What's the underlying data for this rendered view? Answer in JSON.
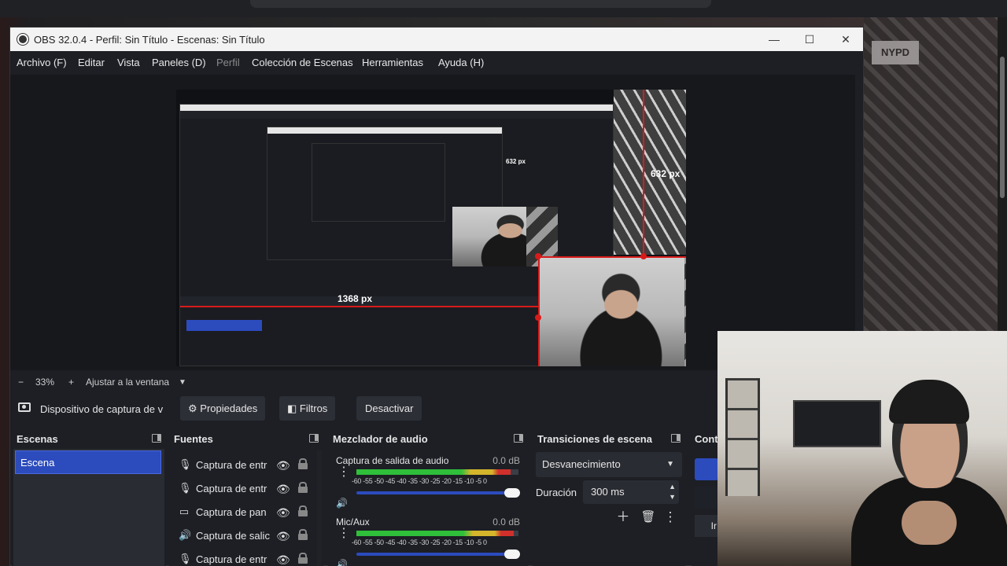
{
  "window": {
    "title": "OBS 32.0.4 - Perfil: Sin Título - Escenas: Sin Título",
    "minimize": "—",
    "maximize": "☐",
    "close": "✕"
  },
  "menu": [
    "Archivo (F)",
    "Editar",
    "Vista",
    "Paneles (D)",
    "Perfil",
    "Colección de Escenas",
    "Herramientas",
    "Ayuda (H)"
  ],
  "preview": {
    "label_height": "632 px",
    "label_width": "1368 px",
    "nested_label_height": "632 px",
    "nested_label_width": "1368 px",
    "tower_text": "NYPD"
  },
  "zoom": {
    "minus": "−",
    "value": "33%",
    "plus": "+",
    "fit": "Ajustar a la ventana",
    "caret": "▼"
  },
  "source_toolbar": {
    "source_name": "Dispositivo de captura de v",
    "properties": "Propiedades",
    "filters": "Filtros",
    "deactivate": "Desactivar"
  },
  "scenes": {
    "title": "Escenas",
    "items": [
      "Escena"
    ]
  },
  "sources": {
    "title": "Fuentes",
    "items": [
      {
        "label": "Captura de entr",
        "icon": "mic-icon"
      },
      {
        "label": "Captura de entr",
        "icon": "mic-icon"
      },
      {
        "label": "Captura de pan",
        "icon": "monitor-icon"
      },
      {
        "label": "Captura de salic",
        "icon": "speaker-icon"
      },
      {
        "label": "Captura de entr",
        "icon": "mic-icon"
      }
    ]
  },
  "mixer": {
    "title": "Mezclador de audio",
    "scale": "-60 -55 -50 -45 -40 -35 -30 -25 -20 -15 -10 -5 0",
    "channels": [
      {
        "name": "Captura de salida de audio",
        "db": "0.0 dB",
        "level": 0.95
      },
      {
        "name": "Mic/Aux",
        "db": "0.0 dB",
        "level": 0.97
      }
    ]
  },
  "transitions": {
    "title": "Transiciones de escena",
    "selected": "Desvanecimiento",
    "duration_label": "Duración",
    "duration_value": "300 ms"
  },
  "controls": {
    "title": "Cont",
    "partial": "Ir"
  },
  "colors": {
    "selection": "#d81b1b",
    "accent": "#2c4bbd"
  }
}
